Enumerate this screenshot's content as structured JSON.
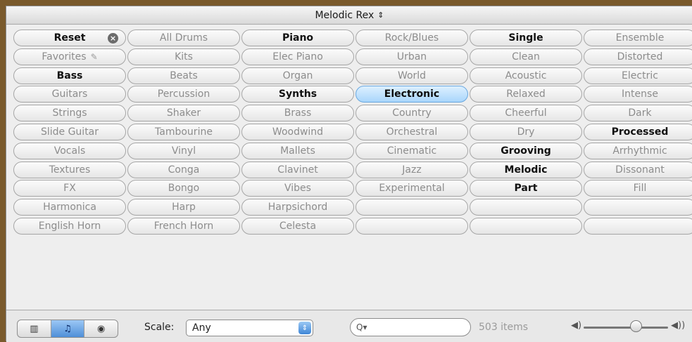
{
  "header": {
    "title": "Melodic Rex",
    "chevron": "⇕"
  },
  "grid": {
    "columns": [
      {
        "buttons": [
          {
            "label": "Reset",
            "state": "on",
            "icon": "reset-x-icon"
          },
          {
            "label": "Favorites",
            "state": "off",
            "icon": "pin-icon"
          },
          {
            "label": "Bass",
            "state": "on"
          },
          {
            "label": "Guitars",
            "state": "off"
          },
          {
            "label": "Strings",
            "state": "off"
          },
          {
            "label": "Slide Guitar",
            "state": "off"
          },
          {
            "label": "Vocals",
            "state": "off"
          },
          {
            "label": "Textures",
            "state": "off"
          },
          {
            "label": "FX",
            "state": "off"
          },
          {
            "label": "Harmonica",
            "state": "off"
          },
          {
            "label": "English Horn",
            "state": "off"
          }
        ]
      },
      {
        "buttons": [
          {
            "label": "All Drums",
            "state": "off"
          },
          {
            "label": "Kits",
            "state": "off"
          },
          {
            "label": "Beats",
            "state": "off"
          },
          {
            "label": "Percussion",
            "state": "off"
          },
          {
            "label": "Shaker",
            "state": "off"
          },
          {
            "label": "Tambourine",
            "state": "off"
          },
          {
            "label": "Vinyl",
            "state": "off"
          },
          {
            "label": "Conga",
            "state": "off"
          },
          {
            "label": "Bongo",
            "state": "off"
          },
          {
            "label": "Harp",
            "state": "off"
          },
          {
            "label": "French Horn",
            "state": "off"
          }
        ]
      },
      {
        "buttons": [
          {
            "label": "Piano",
            "state": "on"
          },
          {
            "label": "Elec Piano",
            "state": "off"
          },
          {
            "label": "Organ",
            "state": "off"
          },
          {
            "label": "Synths",
            "state": "on"
          },
          {
            "label": "Brass",
            "state": "off"
          },
          {
            "label": "Woodwind",
            "state": "off"
          },
          {
            "label": "Mallets",
            "state": "off"
          },
          {
            "label": "Clavinet",
            "state": "off"
          },
          {
            "label": "Vibes",
            "state": "off"
          },
          {
            "label": "Harpsichord",
            "state": "off"
          },
          {
            "label": "Celesta",
            "state": "off"
          }
        ]
      },
      {
        "buttons": [
          {
            "label": "Rock/Blues",
            "state": "off"
          },
          {
            "label": "Urban",
            "state": "off"
          },
          {
            "label": "World",
            "state": "off"
          },
          {
            "label": "Electronic",
            "state": "selected"
          },
          {
            "label": "Country",
            "state": "off"
          },
          {
            "label": "Orchestral",
            "state": "off"
          },
          {
            "label": "Cinematic",
            "state": "off"
          },
          {
            "label": "Jazz",
            "state": "off"
          },
          {
            "label": "Experimental",
            "state": "off"
          },
          {
            "label": "",
            "state": "off"
          },
          {
            "label": "",
            "state": "off"
          }
        ]
      },
      {
        "buttons": [
          {
            "label": "Single",
            "state": "on"
          },
          {
            "label": "Clean",
            "state": "off"
          },
          {
            "label": "Acoustic",
            "state": "off"
          },
          {
            "label": "Relaxed",
            "state": "off"
          },
          {
            "label": "Cheerful",
            "state": "off"
          },
          {
            "label": "Dry",
            "state": "off"
          },
          {
            "label": "Grooving",
            "state": "on"
          },
          {
            "label": "Melodic",
            "state": "on"
          },
          {
            "label": "Part",
            "state": "on"
          },
          {
            "label": "",
            "state": "off"
          },
          {
            "label": "",
            "state": "off"
          }
        ]
      },
      {
        "buttons": [
          {
            "label": "Ensemble",
            "state": "off"
          },
          {
            "label": "Distorted",
            "state": "off"
          },
          {
            "label": "Electric",
            "state": "off"
          },
          {
            "label": "Intense",
            "state": "off"
          },
          {
            "label": "Dark",
            "state": "off"
          },
          {
            "label": "Processed",
            "state": "on"
          },
          {
            "label": "Arrhythmic",
            "state": "off"
          },
          {
            "label": "Dissonant",
            "state": "off"
          },
          {
            "label": "Fill",
            "state": "off"
          },
          {
            "label": "",
            "state": "off"
          },
          {
            "label": "",
            "state": "off"
          }
        ]
      }
    ]
  },
  "footer": {
    "view_modes": [
      {
        "name": "column-view-icon",
        "glyph": "▥",
        "active": false
      },
      {
        "name": "music-note-icon",
        "glyph": "♫",
        "active": true
      },
      {
        "name": "podcast-icon",
        "glyph": "◉",
        "active": false
      }
    ],
    "scale_label": "Scale:",
    "scale_value": "Any",
    "scale_arrows": "⇕",
    "search_glyph": "Q▾",
    "search_placeholder": "",
    "item_count": "503 items",
    "volume_low_glyph": "◀)",
    "volume_high_glyph": "◀))",
    "volume_level": 0.62
  },
  "colors": {
    "selected": "#a9d6fb",
    "active_segment": "#4f8fd8",
    "background": "#7a5a2c"
  }
}
